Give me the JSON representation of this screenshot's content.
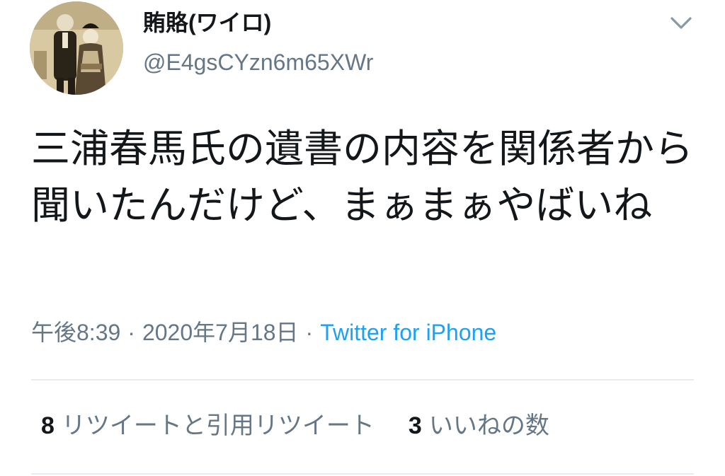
{
  "user": {
    "display_name": "賄賂(ワイロ)",
    "handle": "@E4gsCYzn6m65XWr"
  },
  "tweet": {
    "text": "三浦春馬氏の遺書の内容を関係者から聞いたんだけど、まぁまぁやばいね",
    "time": "午後8:39",
    "separator": "·",
    "date": "2020年7月18日",
    "source": "Twitter for iPhone"
  },
  "stats": {
    "retweets_count": "8",
    "retweets_label": "リツイートと引用リツイート",
    "likes_count": "3",
    "likes_label": "いいねの数"
  },
  "icons": {
    "menu": "chevron-down-icon",
    "avatar": "profile-photo"
  },
  "colors": {
    "text": "#14171a",
    "secondary": "#657786",
    "link": "#1da1f2",
    "divider": "#e6ecf0"
  }
}
